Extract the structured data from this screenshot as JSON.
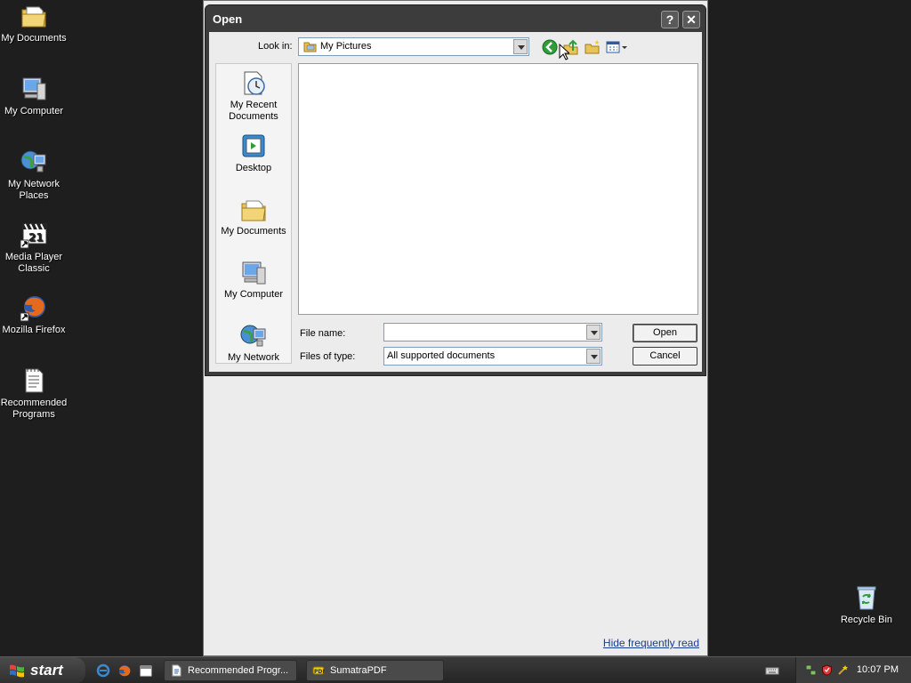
{
  "desktop": {
    "icons": [
      {
        "label": "My Documents",
        "icon": "my-documents-icon"
      },
      {
        "label": "My Computer",
        "icon": "my-computer-icon"
      },
      {
        "label": "My Network Places",
        "icon": "network-places-icon"
      },
      {
        "label": "Media Player Classic",
        "icon": "media-player-classic-icon"
      },
      {
        "label": "Mozilla Firefox",
        "icon": "firefox-icon"
      },
      {
        "label": "Recommended Programs",
        "icon": "document-icon"
      },
      {
        "label": "Recycle Bin",
        "icon": "recycle-bin-icon"
      }
    ]
  },
  "background_app": {
    "hide_link": "Hide frequently read"
  },
  "dialog": {
    "title": "Open",
    "help_button": "?",
    "close_button": "✕",
    "look_in_label": "Look in:",
    "look_in_value": "My Pictures",
    "places": [
      {
        "label": "My Recent Documents",
        "icon": "recent-documents-icon"
      },
      {
        "label": "Desktop",
        "icon": "desktop-icon"
      },
      {
        "label": "My Documents",
        "icon": "my-documents-icon"
      },
      {
        "label": "My Computer",
        "icon": "my-computer-icon"
      },
      {
        "label": "My Network",
        "icon": "network-places-icon"
      }
    ],
    "file_name_label": "File name:",
    "file_name_value": "",
    "files_of_type_label": "Files of type:",
    "files_of_type_value": "All supported documents",
    "open_button": "Open",
    "cancel_button": "Cancel"
  },
  "taskbar": {
    "start_label": "start",
    "tasks": [
      {
        "label": "Recommended Progr...",
        "icon": "document-icon"
      },
      {
        "label": "SumatraPDF",
        "icon": "sumatrapdf-icon"
      }
    ],
    "clock": "10:07 PM"
  },
  "colors": {
    "desktop_bg": "#1e1e1e",
    "link": "#1a3d8f",
    "back_arrow_green": "#2f9e3a"
  }
}
